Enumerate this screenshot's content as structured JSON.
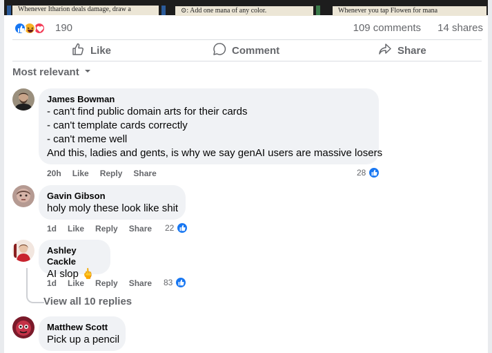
{
  "post": {
    "image_texts": [
      "Whenever Itharion deals damage, draw a",
      ": Add one mana of any color.",
      "Whenever you tap Flowen for mana"
    ],
    "reaction_icons": [
      "like-icon",
      "haha-icon",
      "love-icon"
    ],
    "reaction_count": "190",
    "comments_count": "109 comments",
    "shares_count": "14 shares"
  },
  "actions": {
    "like": "Like",
    "comment": "Comment",
    "share": "Share"
  },
  "sort_label": "Most relevant",
  "comments": [
    {
      "name": "James Bowman",
      "lines": [
        "- can't find public domain arts for their cards",
        "- can't template cards correctly",
        "- can't meme well",
        "And this, ladies and gents, is why we say genAI users are massive losers"
      ],
      "time": "20h",
      "like": "Like",
      "reply": "Reply",
      "share": "Share",
      "likes": "28"
    },
    {
      "name": "Gavin Gibson",
      "lines": [
        "holy moly these look like shit"
      ],
      "time": "1d",
      "like": "Like",
      "reply": "Reply",
      "share": "Share",
      "likes": "22"
    },
    {
      "name": "Ashley Cackle",
      "lines": [
        "AI slop 🖕"
      ],
      "time": "1d",
      "like": "Like",
      "reply": "Reply",
      "share": "Share",
      "likes": "83"
    },
    {
      "name": "Matthew Scott",
      "lines": [
        "Pick up a pencil"
      ]
    }
  ],
  "view_replies": "View all 10 replies",
  "colors": {
    "accent": "#1877f2",
    "muted": "#65676b",
    "bubble": "#f0f2f5"
  }
}
